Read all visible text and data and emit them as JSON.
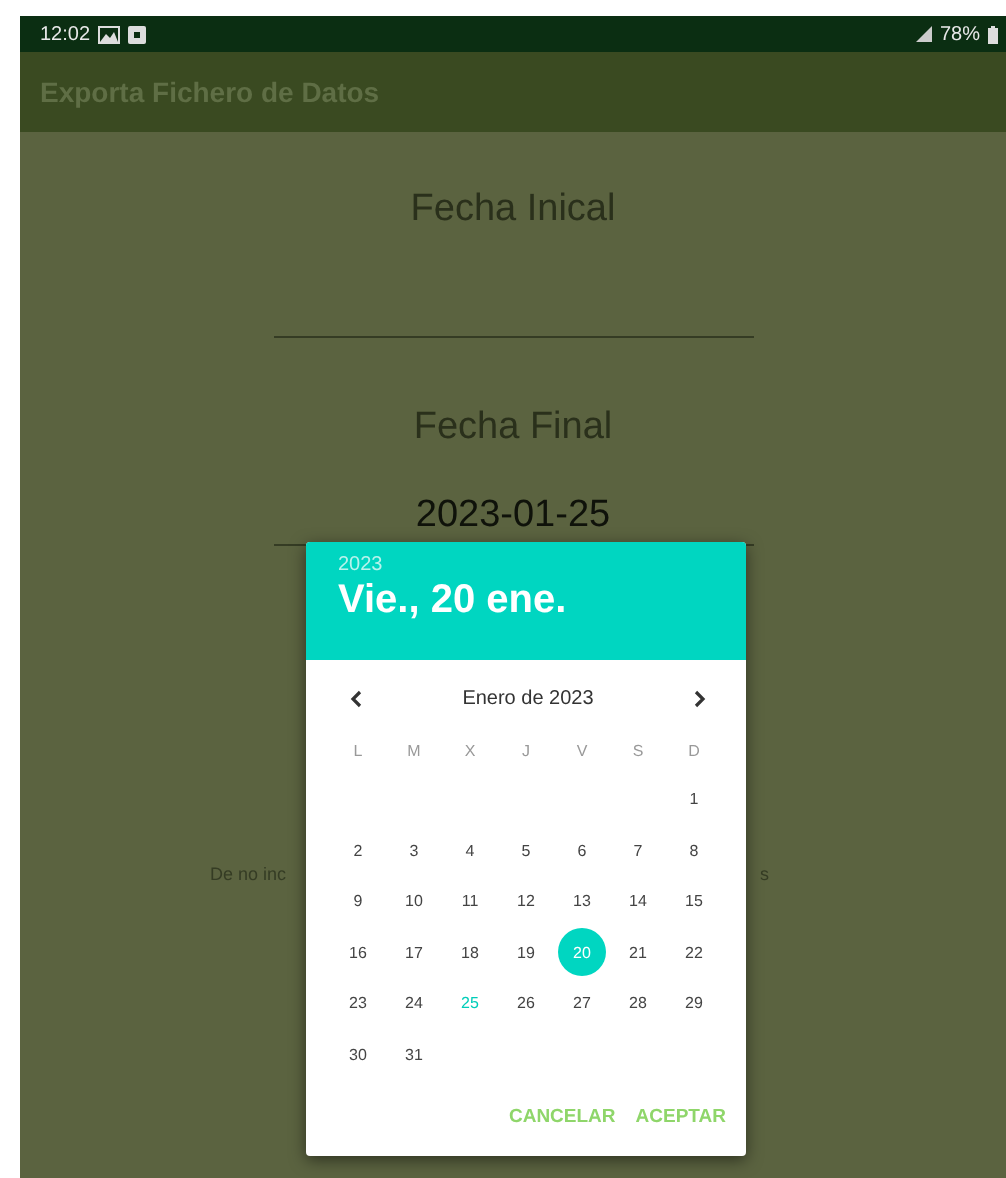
{
  "status_bar": {
    "time": "12:02",
    "battery": "78%"
  },
  "app_bar": {
    "title": "Exporta Fichero de Datos"
  },
  "form": {
    "start_label": "Fecha Inical",
    "end_label": "Fecha Final",
    "end_value": "2023-01-25",
    "note_left": "De no inc",
    "note_right": "s"
  },
  "date_picker": {
    "year": "2023",
    "date": "Vie., 20 ene.",
    "month": "Enero de 2023",
    "weekdays": [
      "L",
      "M",
      "X",
      "J",
      "V",
      "S",
      "D"
    ],
    "weeks": [
      [
        {
          "kind": "blank"
        },
        {
          "kind": "blank"
        },
        {
          "kind": "blank"
        },
        {
          "kind": "blank"
        },
        {
          "kind": "blank"
        },
        {
          "kind": "blank"
        },
        {
          "kind": "day",
          "label": "1",
          "selected": false,
          "today": false
        }
      ],
      [
        {
          "label": "2",
          "selected": false,
          "today": false
        },
        {
          "label": "3",
          "selected": false,
          "today": false
        },
        {
          "label": "4",
          "selected": false,
          "today": false
        },
        {
          "label": "5",
          "selected": false,
          "today": false
        },
        {
          "label": "6",
          "selected": false,
          "today": false
        },
        {
          "label": "7",
          "selected": false,
          "today": false
        },
        {
          "label": "8",
          "selected": false,
          "today": false
        }
      ],
      [
        {
          "label": "9",
          "selected": false,
          "today": false
        },
        {
          "label": "10",
          "selected": false,
          "today": false
        },
        {
          "label": "11",
          "selected": false,
          "today": false
        },
        {
          "label": "12",
          "selected": false,
          "today": false
        },
        {
          "label": "13",
          "selected": false,
          "today": false
        },
        {
          "label": "14",
          "selected": false,
          "today": false
        },
        {
          "label": "15",
          "selected": false,
          "today": false
        }
      ],
      [
        {
          "label": "16",
          "selected": false,
          "today": false
        },
        {
          "label": "17",
          "selected": false,
          "today": false
        },
        {
          "label": "18",
          "selected": false,
          "today": false
        },
        {
          "label": "19",
          "selected": false,
          "today": false
        },
        {
          "label": "20",
          "selected": true,
          "today": false
        },
        {
          "label": "21",
          "selected": false,
          "today": false
        },
        {
          "label": "22",
          "selected": false,
          "today": false
        }
      ],
      [
        {
          "label": "23",
          "selected": false,
          "today": false
        },
        {
          "label": "24",
          "selected": false,
          "today": false
        },
        {
          "label": "25",
          "selected": false,
          "today": true
        },
        {
          "label": "26",
          "selected": false,
          "today": false
        },
        {
          "label": "27",
          "selected": false,
          "today": false
        },
        {
          "label": "28",
          "selected": false,
          "today": false
        },
        {
          "label": "29",
          "selected": false,
          "today": false
        }
      ],
      [
        {
          "label": "30",
          "selected": false,
          "today": false
        },
        {
          "label": "31",
          "selected": false,
          "today": false
        },
        {
          "kind": "blank"
        },
        {
          "kind": "blank"
        },
        {
          "kind": "blank"
        },
        {
          "kind": "blank"
        },
        {
          "kind": "blank"
        }
      ]
    ],
    "buttons": [
      "CANCELAR",
      "ACEPTAR"
    ]
  }
}
